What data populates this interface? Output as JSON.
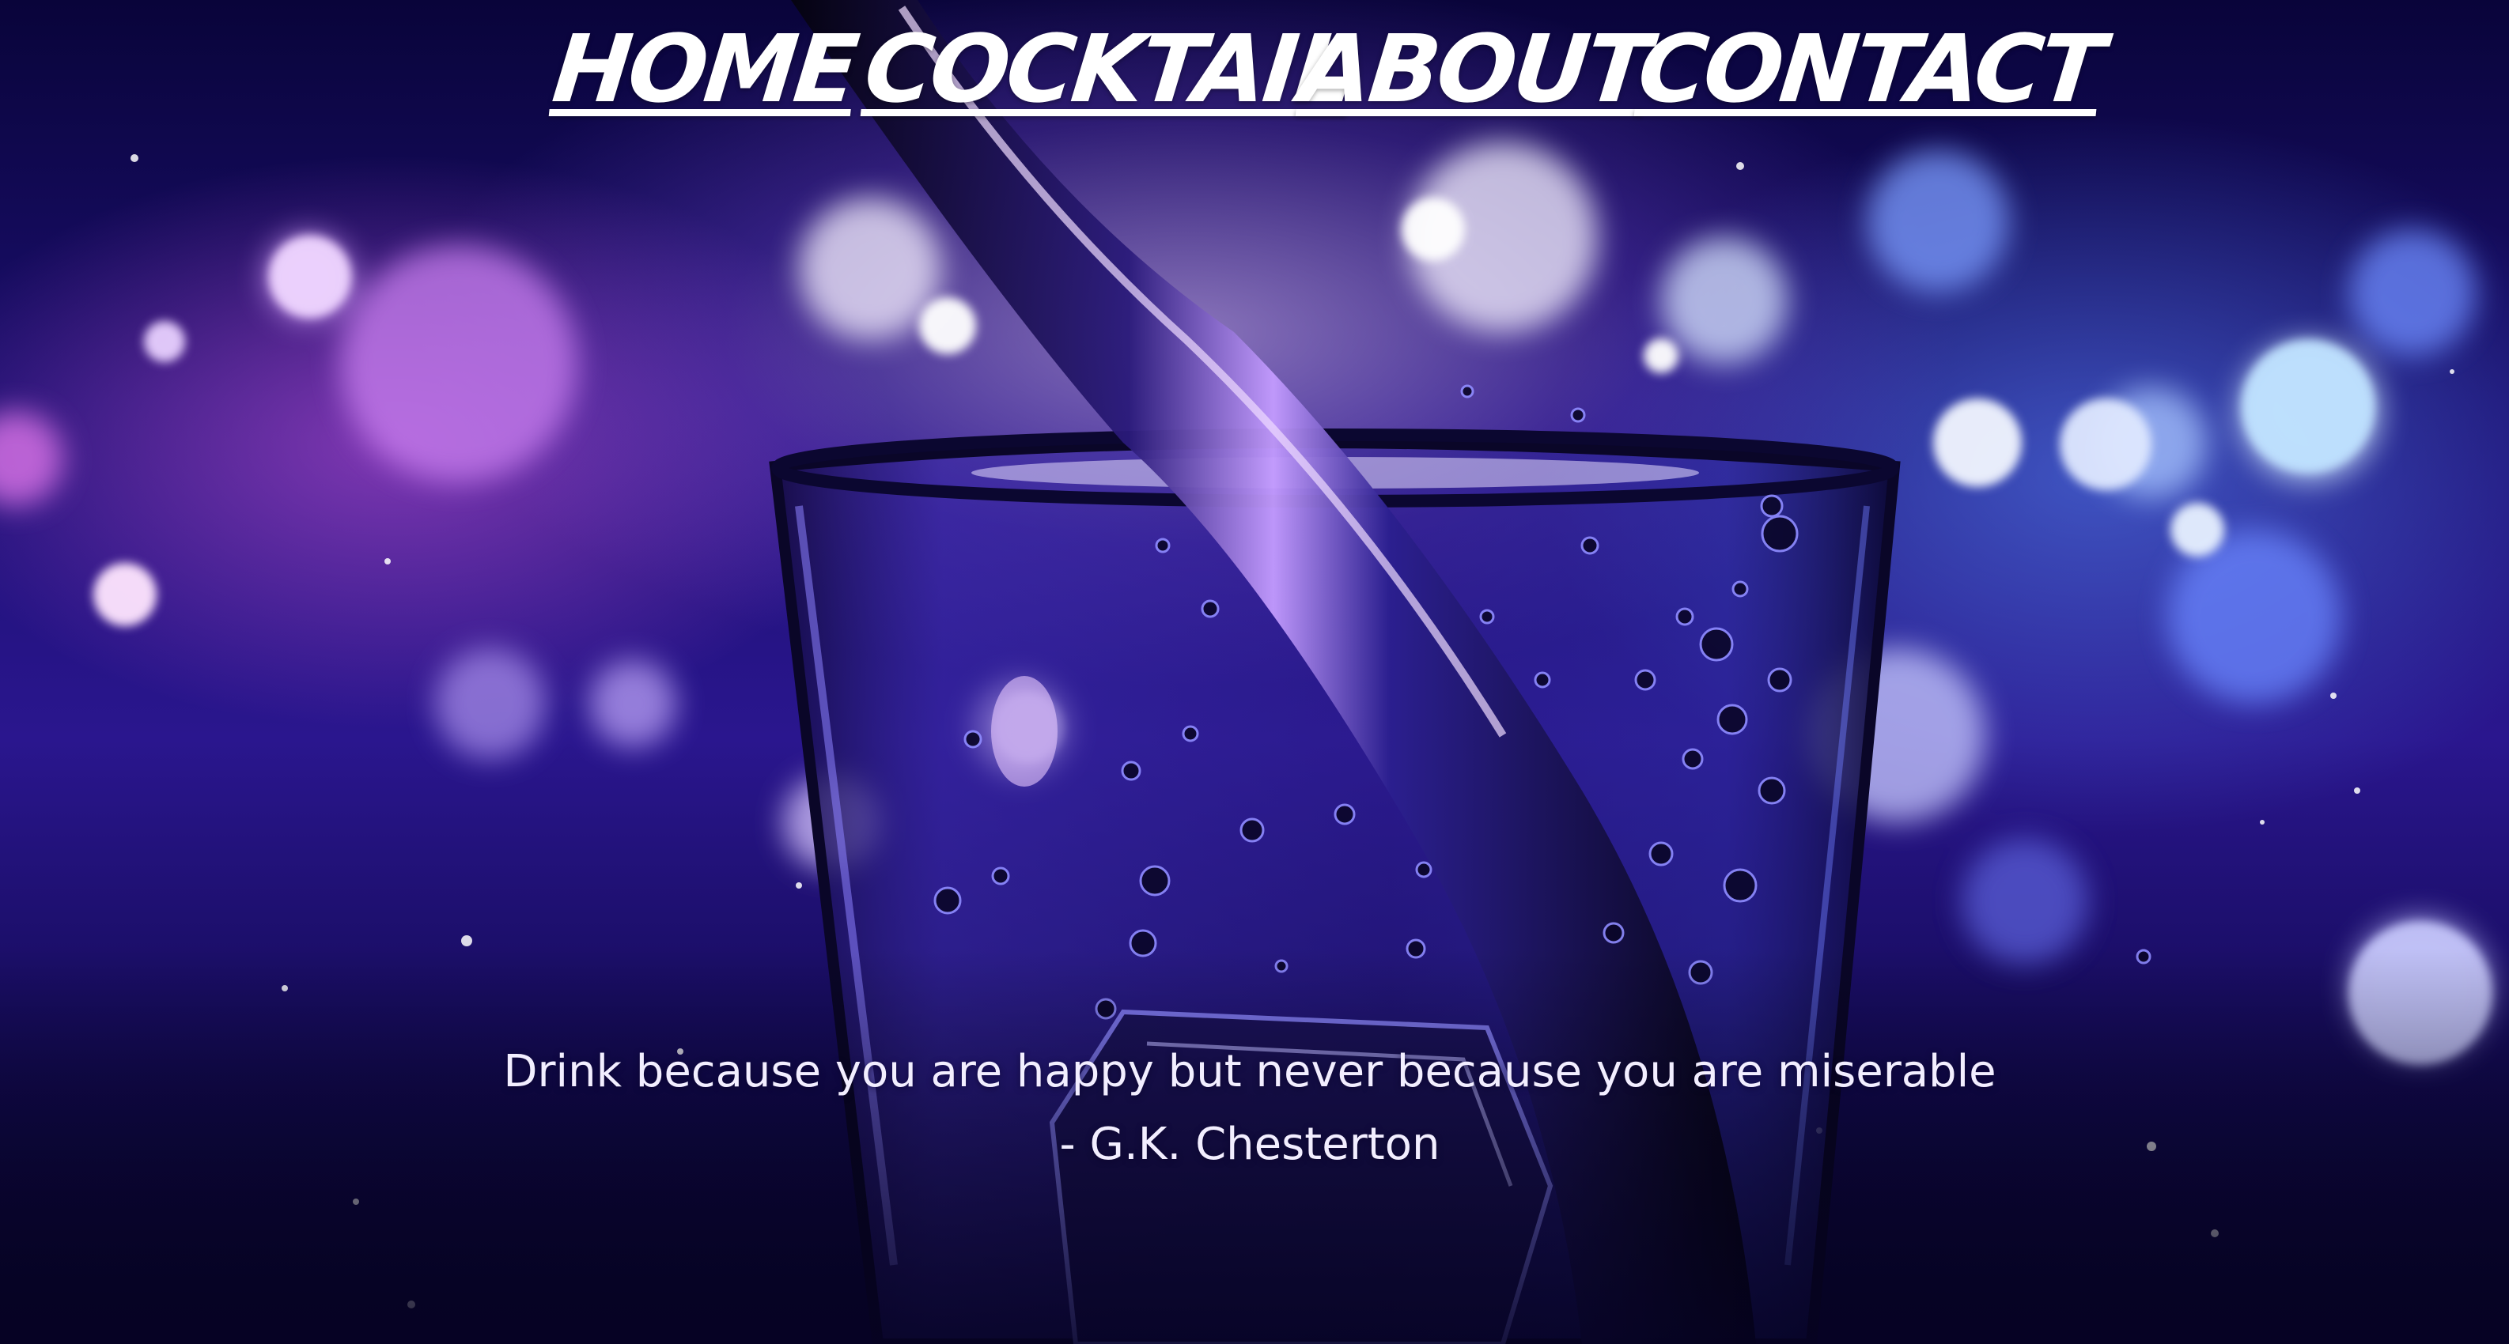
{
  "nav": {
    "items": [
      {
        "label": "HOME"
      },
      {
        "label": "COCKTAIL"
      },
      {
        "label": "ABOUT"
      },
      {
        "label": "CONTACT"
      }
    ]
  },
  "quote": {
    "text": "Drink because you are happy but never because you are miserable",
    "author": "- G.K. Chesterton"
  },
  "colors": {
    "text": "#ffffff",
    "background_dark": "#0c0540",
    "accent_purple": "#b46cf0",
    "accent_blue": "#4a6cff"
  },
  "background_image": "cocktail-glass-pour-icon"
}
